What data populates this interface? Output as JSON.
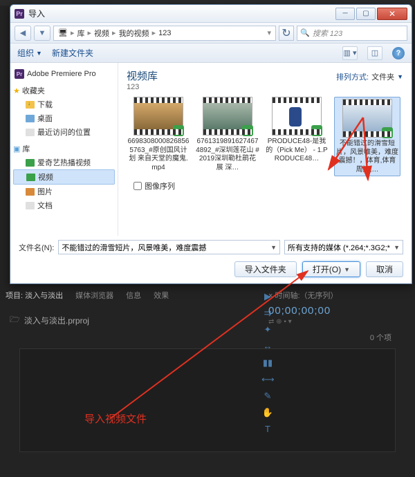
{
  "dialog": {
    "title": "导入",
    "nav": {
      "back": "◀",
      "fwd": "▼"
    },
    "breadcrumb": [
      "库",
      "视频",
      "我的视频",
      "123"
    ],
    "search_placeholder": "搜索 123",
    "toolbar": {
      "organize": "组织",
      "new_folder": "新建文件夹"
    },
    "sidebar": {
      "app": "Adobe Premiere Pro",
      "favorites": "收藏夹",
      "fav_items": [
        "下载",
        "桌面",
        "最近访问的位置"
      ],
      "library": "库",
      "lib_items": [
        "爱奇艺热播视频",
        "视频",
        "图片",
        "文档"
      ]
    },
    "content": {
      "title": "视频库",
      "subtitle": "123",
      "sort_label": "排列方式:",
      "sort_value": "文件夹",
      "thumbs": [
        "66983080008268565763_#原创国风计划 来自天堂的魔鬼.mp4",
        "67613198916274674892_#深圳莲花山 #2019深圳勒杜鹃花展  深…",
        "PRODUCE48-是我的（Pick Me） - 1.PRODUCE48…",
        "不能错过的滑雪短片，风景唯美，难度震撼！，体育,体育周边,…"
      ],
      "sequence_label": "图像序列"
    },
    "footer": {
      "filename_label": "文件名(N):",
      "filename_value": "不能错过的滑雪短片，风景唯美，难度震撼",
      "filetype": "所有支持的媒体 (*.264;*.3G2;*",
      "import_folder": "导入文件夹",
      "open": "打开(O)",
      "cancel": "取消"
    }
  },
  "premiere": {
    "tabs": [
      "项目: 淡入与淡出",
      "媒体浏览器",
      "信息",
      "效果"
    ],
    "project_name": "淡入与淡出.prproj",
    "items_count": "0 个项",
    "timeline_label": "时间轴:（无序列）",
    "timecode": "00;00;00;00",
    "tc_sub": "⇄  ⊕  ▪  ▾"
  },
  "annotation": {
    "text": "导入视频文件"
  }
}
